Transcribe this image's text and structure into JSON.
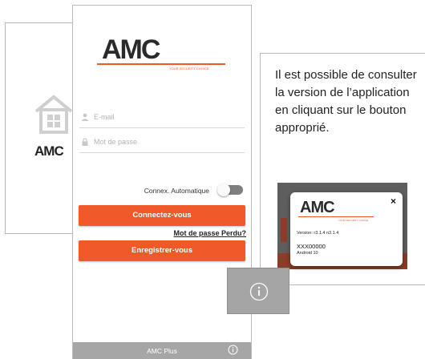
{
  "splash": {
    "logo": "AMC"
  },
  "app": {
    "logo": "AMC",
    "tagline": "YOUR SECURITY CHOICE",
    "email_placeholder": "E-mail",
    "password_placeholder": "Mot de passe",
    "auto_connect_label": "Connex. Automatique",
    "auto_connect_enabled": false,
    "login_button": "Connectez-vous",
    "forgot_password": "Mot de passe Perdu?",
    "register_button": "Enregistrer-vous",
    "bottom_bar_title": "AMC Plus",
    "info_icon": "info-icon"
  },
  "explanation": {
    "text": "Il est possible de consulter la version de l’application en cliquant sur le bouton approprié."
  },
  "version_dialog": {
    "logo": "AMC",
    "tagline": "YOUR SECURITY CHOICE",
    "close_label": "×",
    "version": "Version: r3.1.4 n3.1.4",
    "serial": "XXX00000",
    "android": "Android 10"
  },
  "colors": {
    "accent": "#f05a28",
    "bar": "#a6a6a6"
  }
}
